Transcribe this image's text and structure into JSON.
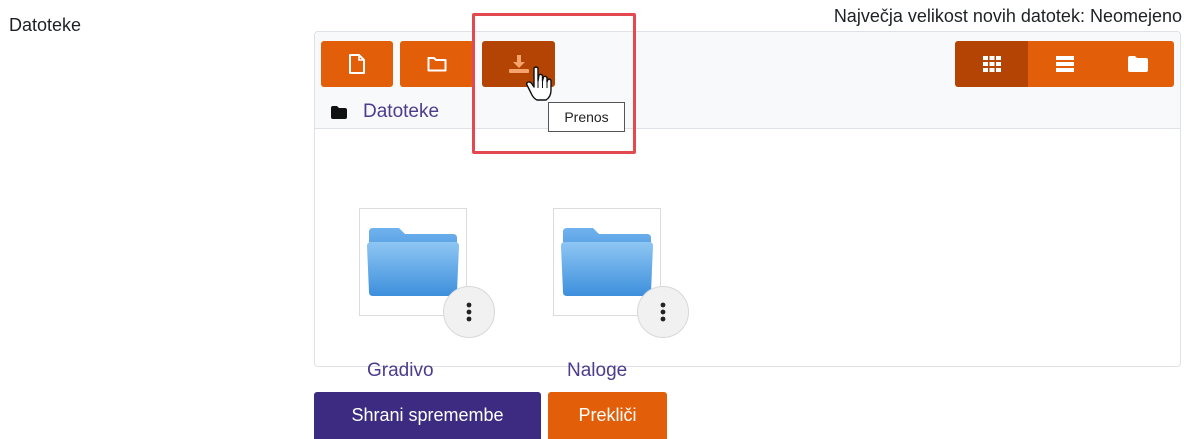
{
  "field": {
    "label": "Datoteke",
    "max_size_text": "Največja velikost novih datotek: Neomejeno"
  },
  "toolbar": {
    "buttons": [
      {
        "icon": "new-file-icon"
      },
      {
        "icon": "new-folder-icon"
      },
      {
        "icon": "download-icon",
        "active": true,
        "tooltip": "Prenos"
      }
    ],
    "views": [
      {
        "icon": "grid-view-icon",
        "active": true
      },
      {
        "icon": "list-view-icon",
        "active": false
      },
      {
        "icon": "folder-tree-view-icon",
        "active": false
      }
    ]
  },
  "path": {
    "label": "Datoteke"
  },
  "files": [
    {
      "name": "Gradivo",
      "type": "folder"
    },
    {
      "name": "Naloge",
      "type": "folder"
    }
  ],
  "actions": {
    "save_label": "Shrani spremembe",
    "cancel_label": "Prekliči"
  },
  "colors": {
    "accent": "#e35e09",
    "accent_active": "#b34403",
    "primary": "#3c2b80",
    "link": "#4d3c8e",
    "highlight": "#e34a4f"
  }
}
